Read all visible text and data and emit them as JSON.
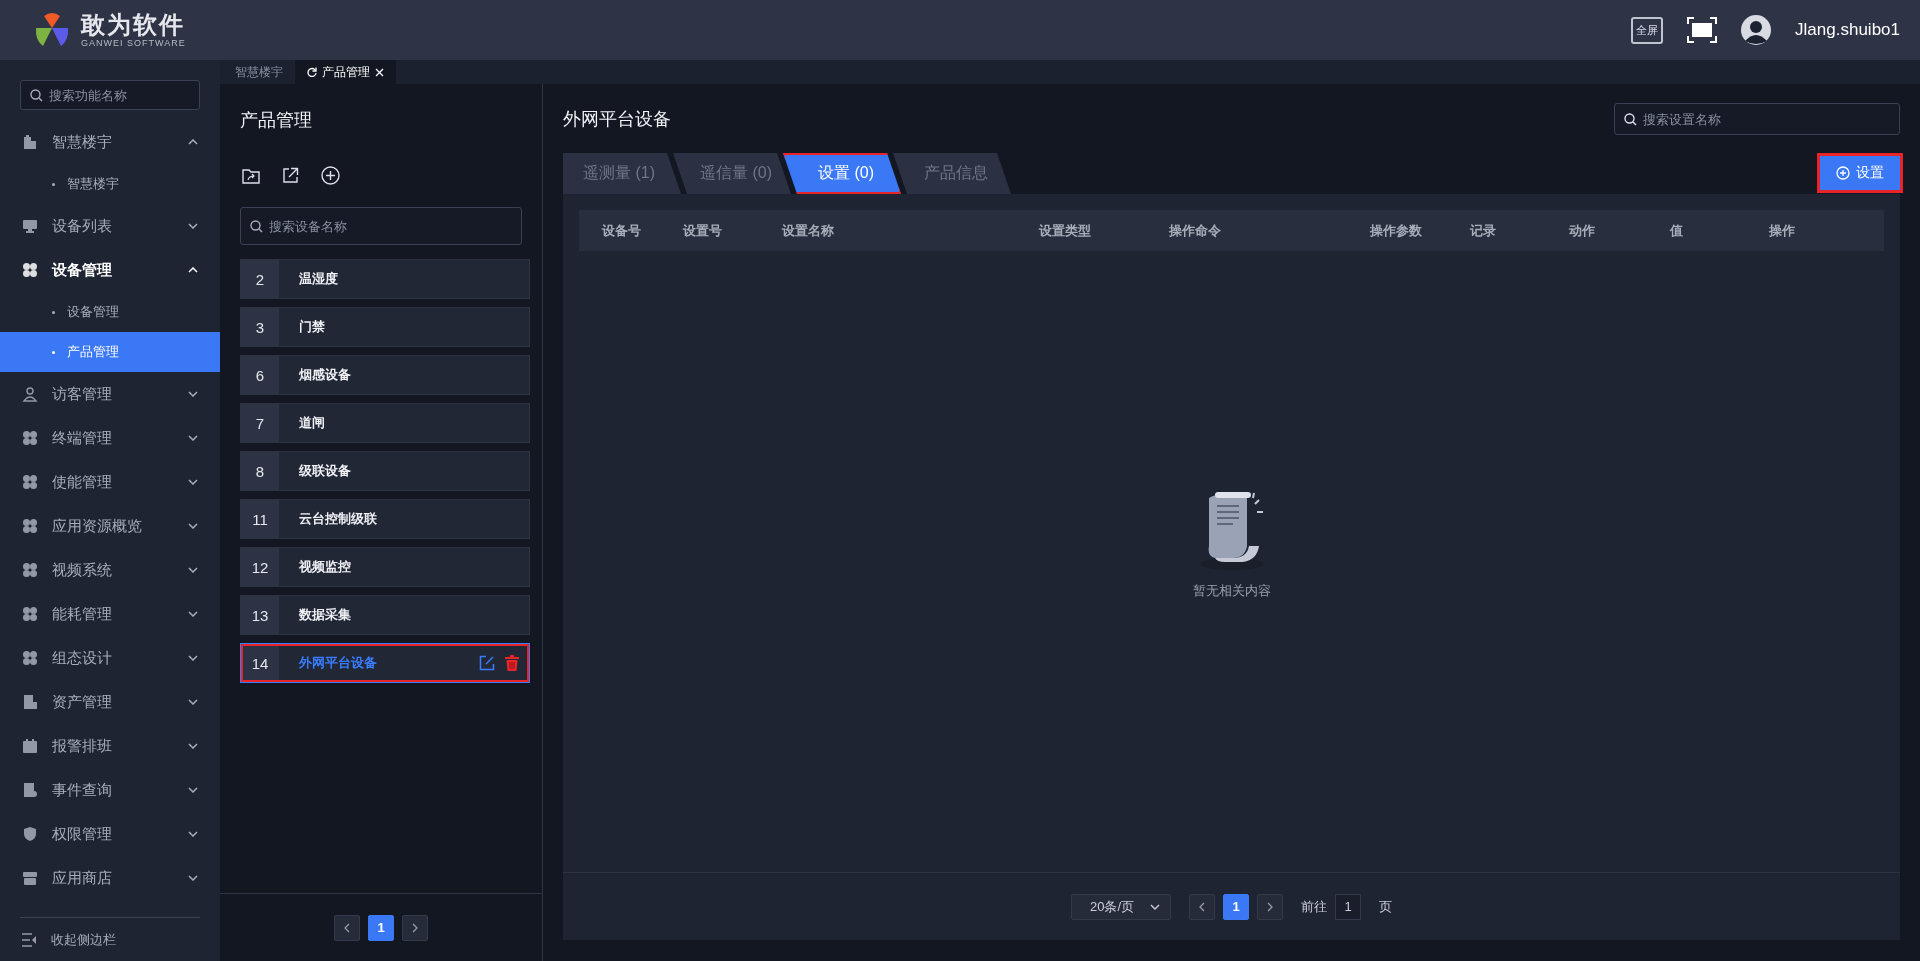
{
  "header": {
    "logo_title": "敢为软件",
    "logo_subtitle": "GANWEI SOFTWARE",
    "fullscreen_label": "全屏",
    "username": "Jlang.shuibo1"
  },
  "sidebar": {
    "search": {
      "placeholder": "搜索功能名称"
    },
    "items": [
      {
        "label": "智慧楼宇",
        "selected": false,
        "expanded": true,
        "children": [
          {
            "label": "智慧楼宇",
            "selected": false
          }
        ]
      },
      {
        "label": "设备列表",
        "selected": false,
        "expanded": false
      },
      {
        "label": "设备管理",
        "selected": true,
        "expanded": true,
        "children": [
          {
            "label": "设备管理",
            "selected": false
          },
          {
            "label": "产品管理",
            "selected": true
          }
        ]
      },
      {
        "label": "访客管理",
        "selected": false,
        "expanded": false
      },
      {
        "label": "终端管理",
        "selected": false,
        "expanded": false
      },
      {
        "label": "使能管理",
        "selected": false,
        "expanded": false
      },
      {
        "label": "应用资源概览",
        "selected": false,
        "expanded": false
      },
      {
        "label": "视频系统",
        "selected": false,
        "expanded": false
      },
      {
        "label": "能耗管理",
        "selected": false,
        "expanded": false
      },
      {
        "label": "组态设计",
        "selected": false,
        "expanded": false
      },
      {
        "label": "资产管理",
        "selected": false,
        "expanded": false
      },
      {
        "label": "报警排班",
        "selected": false,
        "expanded": false
      },
      {
        "label": "事件查询",
        "selected": false,
        "expanded": false
      },
      {
        "label": "权限管理",
        "selected": false,
        "expanded": false
      },
      {
        "label": "应用商店",
        "selected": false,
        "expanded": false
      }
    ],
    "collapse_label": "收起侧边栏"
  },
  "page_tabs": [
    {
      "label": "智慧楼宇",
      "selected": false
    },
    {
      "label": "产品管理",
      "selected": true
    }
  ],
  "product_panel": {
    "title": "产品管理",
    "search": {
      "placeholder": "搜索设备名称"
    },
    "devices": [
      {
        "number": "2",
        "name": "温湿度",
        "selected": false,
        "highlighted": false
      },
      {
        "number": "3",
        "name": "门禁",
        "selected": false,
        "highlighted": false
      },
      {
        "number": "6",
        "name": "烟感设备",
        "selected": false,
        "highlighted": false
      },
      {
        "number": "7",
        "name": "道闸",
        "selected": false,
        "highlighted": false
      },
      {
        "number": "8",
        "name": "级联设备",
        "selected": false,
        "highlighted": false
      },
      {
        "number": "11",
        "name": "云台控制级联",
        "selected": false,
        "highlighted": false
      },
      {
        "number": "12",
        "name": "视频监控",
        "selected": false,
        "highlighted": false
      },
      {
        "number": "13",
        "name": "数据采集",
        "selected": false,
        "highlighted": false
      },
      {
        "number": "14",
        "name": "外网平台设备",
        "selected": true,
        "highlighted": true
      }
    ],
    "pagination": {
      "pages": [
        {
          "label": "1",
          "selected": true
        }
      ]
    }
  },
  "detail": {
    "title": "外网平台设备",
    "search": {
      "placeholder": "搜索设置名称"
    },
    "tabs": [
      {
        "label": "遥测量 (1)",
        "selected": false,
        "highlighted": false
      },
      {
        "label": "遥信量 (0)",
        "selected": false,
        "highlighted": false
      },
      {
        "label": "设置 (0)",
        "selected": true,
        "highlighted": true
      },
      {
        "label": "产品信息",
        "selected": false,
        "highlighted": false
      }
    ],
    "add_button": {
      "label": "设置",
      "highlighted": true
    },
    "table": {
      "columns": [
        "设备号",
        "设置号",
        "设置名称",
        "设置类型",
        "操作命令",
        "操作参数",
        "记录",
        "动作",
        "值",
        "操作"
      ]
    },
    "empty_text": "暂无相关内容",
    "pagination": {
      "page_size": "20条/页",
      "pages": [
        {
          "label": "1",
          "selected": true
        }
      ],
      "goto_label": "前往",
      "goto_value": "1",
      "page_suffix": "页"
    }
  }
}
